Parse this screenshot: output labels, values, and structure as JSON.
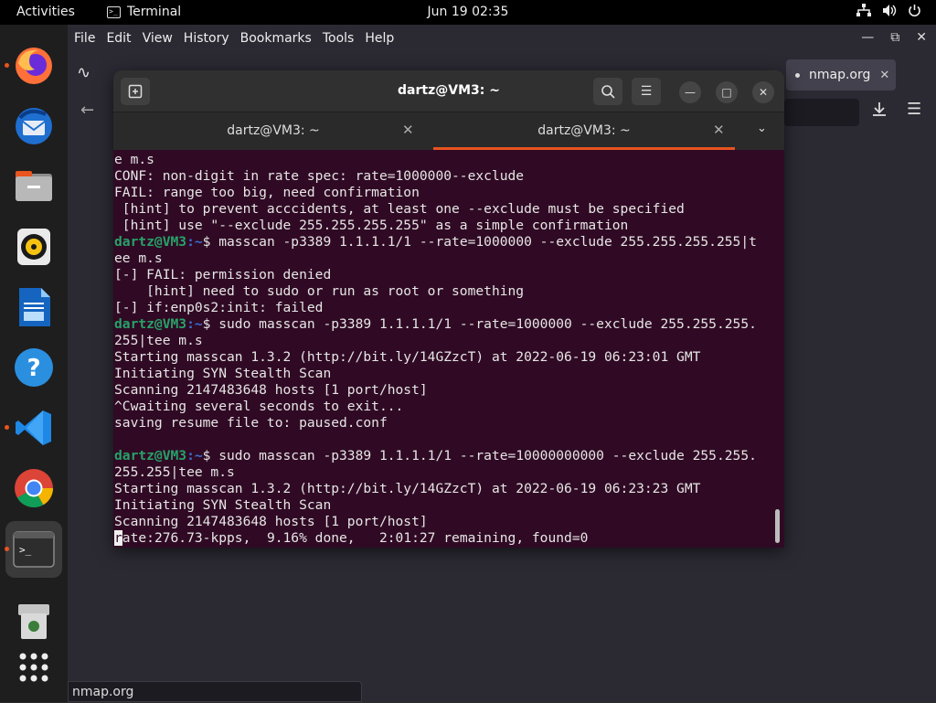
{
  "topbar": {
    "activities": "Activities",
    "app_name": "Terminal",
    "clock": "Jun 19  02:35"
  },
  "dock": {
    "items": [
      "firefox",
      "thunderbird",
      "files",
      "rhythmbox",
      "libreoffice-writer",
      "help",
      "vscode",
      "chrome",
      "terminal",
      "trash",
      "show-apps"
    ]
  },
  "firefox": {
    "menu": [
      "File",
      "Edit",
      "View",
      "History",
      "Bookmarks",
      "Tools",
      "Help"
    ],
    "active_tab": "nmap.org",
    "status_url": "nmap.org"
  },
  "terminal": {
    "title": "dartz@VM3: ~",
    "tabs": [
      {
        "label": "dartz@VM3: ~",
        "active": false
      },
      {
        "label": "dartz@VM3: ~",
        "active": true
      }
    ],
    "lines": [
      {
        "text": "e m.s"
      },
      {
        "text": "CONF: non-digit in rate spec: rate=1000000--exclude"
      },
      {
        "text": "FAIL: range too big, need confirmation"
      },
      {
        "text": " [hint] to prevent acccidents, at least one --exclude must be specified"
      },
      {
        "text": " [hint] use \"--exclude 255.255.255.255\" as a simple confirmation"
      },
      {
        "prompt_user": "dartz@VM3",
        "prompt_path": ":~",
        "text": "$ masscan -p3389 1.1.1.1/1 --rate=1000000 --exclude 255.255.255.255|t"
      },
      {
        "text": "ee m.s"
      },
      {
        "text": "[-] FAIL: permission denied"
      },
      {
        "text": "    [hint] need to sudo or run as root or something"
      },
      {
        "text": "[-] if:enp0s2:init: failed"
      },
      {
        "prompt_user": "dartz@VM3",
        "prompt_path": ":~",
        "text": "$ sudo masscan -p3389 1.1.1.1/1 --rate=1000000 --exclude 255.255.255."
      },
      {
        "text": "255|tee m.s"
      },
      {
        "text": "Starting masscan 1.3.2 (http://bit.ly/14GZzcT) at 2022-06-19 06:23:01 GMT"
      },
      {
        "text": "Initiating SYN Stealth Scan"
      },
      {
        "text": "Scanning 2147483648 hosts [1 port/host]"
      },
      {
        "text": "^Cwaiting several seconds to exit..."
      },
      {
        "text": "saving resume file to: paused.conf"
      },
      {
        "text": ""
      },
      {
        "prompt_user": "dartz@VM3",
        "prompt_path": ":~",
        "text": "$ sudo masscan -p3389 1.1.1.1/1 --rate=10000000000 --exclude 255.255."
      },
      {
        "text": "255.255|tee m.s"
      },
      {
        "text": "Starting masscan 1.3.2 (http://bit.ly/14GZzcT) at 2022-06-19 06:23:23 GMT"
      },
      {
        "text": "Initiating SYN Stealth Scan"
      },
      {
        "text": "Scanning 2147483648 hosts [1 port/host]"
      },
      {
        "cursor_char": "r",
        "text": "ate:276.73-kpps,  9.16% done,   2:01:27 remaining, found=0"
      }
    ]
  }
}
